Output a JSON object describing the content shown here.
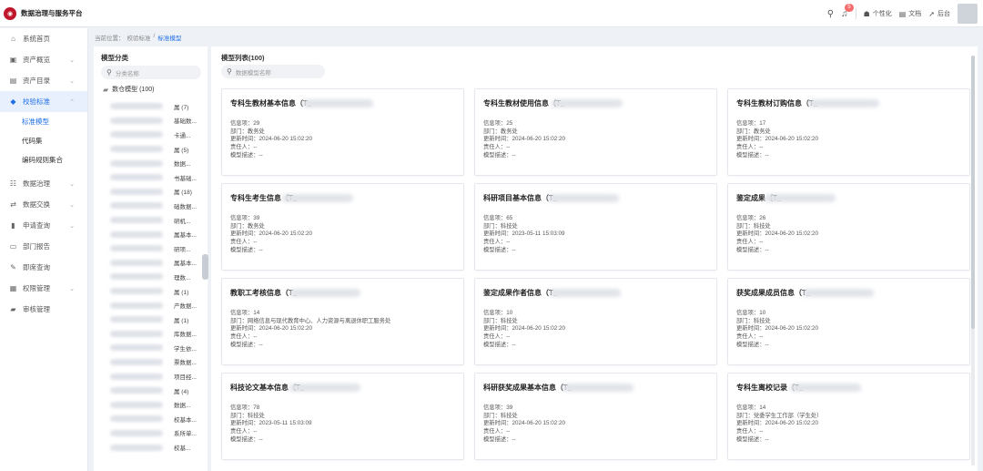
{
  "app": {
    "title": "数据治理与服务平台",
    "logo_icon": "logo-seal-icon"
  },
  "header": {
    "notification_count": "5",
    "links": [
      {
        "icon": "graduation-cap-icon",
        "glyph": "☗",
        "label": "个性化"
      },
      {
        "icon": "document-icon",
        "glyph": "▤",
        "label": "文档"
      },
      {
        "icon": "arrow-icon",
        "glyph": "➚",
        "label": "后台"
      }
    ]
  },
  "sidebar": {
    "items": [
      {
        "label": "系统首页",
        "icon": "home-icon",
        "glyph": "⌂",
        "chevron": ""
      },
      {
        "label": "资产概览",
        "icon": "asset-icon",
        "glyph": "▣",
        "chevron": "⌄"
      },
      {
        "label": "资产目录",
        "icon": "catalog-icon",
        "glyph": "▤",
        "chevron": "⌄"
      },
      {
        "label": "校验标准",
        "icon": "diamond-icon",
        "glyph": "◆",
        "chevron": "⌃",
        "active": true
      },
      {
        "label": "数据治理",
        "icon": "people-icon",
        "glyph": "☷",
        "chevron": "⌄"
      },
      {
        "label": "数据交换",
        "icon": "exchange-icon",
        "glyph": "⇄",
        "chevron": "⌄"
      },
      {
        "label": "申请查询",
        "icon": "bar-chart-icon",
        "glyph": "▮",
        "chevron": "⌄"
      },
      {
        "label": "部门报告",
        "icon": "monitor-icon",
        "glyph": "▭",
        "chevron": ""
      },
      {
        "label": "即席查询",
        "icon": "query-icon",
        "glyph": "✎",
        "chevron": ""
      },
      {
        "label": "权限管理",
        "icon": "grid-icon",
        "glyph": "▦",
        "chevron": "⌄"
      },
      {
        "label": "审核管理",
        "icon": "review-icon",
        "glyph": "▰",
        "chevron": ""
      }
    ],
    "sub_items": [
      "标准模型",
      "代码集",
      "编码规则集合"
    ]
  },
  "breadcrumb": {
    "prefix": "当前位置：",
    "parent": "校验标准",
    "sep": "/",
    "current": "标准模型"
  },
  "category_panel": {
    "title": "模型分类",
    "search_placeholder": "分类名称",
    "root_label": "数仓模型 (100)",
    "rows": [
      "属 (7)",
      "基础数...",
      "卡通...",
      "属 (5)",
      "数据...",
      "书基础...",
      "属 (18)",
      "础数据...",
      "研机...",
      "属基本...",
      "研项...",
      "属基本...",
      "理数...",
      "属 (1)",
      "产数据...",
      "属 (1)",
      "库数据...",
      "学生依...",
      "票数据...",
      "项目经...",
      "属 (4)",
      "数据...",
      "校基本...",
      "系所单...",
      "校基..."
    ]
  },
  "list_panel": {
    "title": "模型列表(100)",
    "search_placeholder": "数据模型名称",
    "labels": {
      "count": "信息项：",
      "dept": "部门：",
      "updated": "更新时间：",
      "owner": "责任人：",
      "desc": "模型描述："
    },
    "cards": [
      {
        "title": "专科生教材基本信息（T_",
        "count": "29",
        "dept": "教务处",
        "updated": "2024-06-20 15:02:20",
        "owner": "--",
        "desc": "--"
      },
      {
        "title": "专科生教材使用信息（T_",
        "count": "25",
        "dept": "教务处",
        "updated": "2024-06-20 15:02:20",
        "owner": "--",
        "desc": "--"
      },
      {
        "title": "专科生教材订购信息（T_",
        "count": "17",
        "dept": "教务处",
        "updated": "2024-06-20 15:02:20",
        "owner": "--",
        "desc": "--"
      },
      {
        "title": "专科生考生信息（T_",
        "count": "39",
        "dept": "教务处",
        "updated": "2024-06-20 15:02:20",
        "owner": "--",
        "desc": "--"
      },
      {
        "title": "科研项目基本信息（T_",
        "count": "65",
        "dept": "科技处",
        "updated": "2023-05-11 15:03:09",
        "owner": "--",
        "desc": "--"
      },
      {
        "title": "鉴定成果（T_",
        "count": "26",
        "dept": "科技处",
        "updated": "2024-06-20 15:02:20",
        "owner": "--",
        "desc": "--"
      },
      {
        "title": "教职工考核信息（T_",
        "count": "14",
        "dept": "网络信息与现代教育中心、人力资源与离退休职工服务处",
        "updated": "2024-06-20 15:02:20",
        "owner": "--",
        "desc": "--"
      },
      {
        "title": "鉴定成果作者信息（T_",
        "count": "10",
        "dept": "科技处",
        "updated": "2024-06-20 15:02:20",
        "owner": "--",
        "desc": "--"
      },
      {
        "title": "获奖成果成员信息（T_",
        "count": "10",
        "dept": "科技处",
        "updated": "2024-06-20 15:02:20",
        "owner": "--",
        "desc": "--"
      },
      {
        "title": "科技论文基本信息（T_",
        "count": "78",
        "dept": "科技处",
        "updated": "2023-05-11 15:03:09",
        "owner": "--",
        "desc": "--"
      },
      {
        "title": "科研获奖成果基本信息（T_",
        "count": "39",
        "dept": "科技处",
        "updated": "2024-06-20 15:02:20",
        "owner": "--",
        "desc": "--"
      },
      {
        "title": "专科生离校记录（T_",
        "count": "14",
        "dept": "党委学生工作部（学生处）",
        "updated": "2024-06-20 15:02:20",
        "owner": "--",
        "desc": "--"
      }
    ]
  },
  "colors": {
    "accent": "#1f6fe5",
    "brand": "#c0162b",
    "active_bg": "#e8f0fe",
    "badge": "#f56c6c"
  }
}
